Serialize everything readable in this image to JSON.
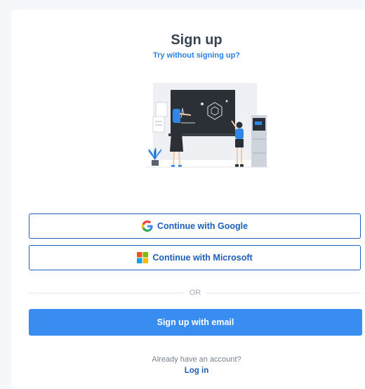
{
  "header": {
    "title": "Sign up",
    "subtitle_link": "Try without signing up?"
  },
  "buttons": {
    "google": "Continue with Google",
    "microsoft": "Continue with Microsoft",
    "email": "Sign up with email"
  },
  "divider": "OR",
  "footer": {
    "prompt": "Already have an account?",
    "login_link": "Log in"
  },
  "colors": {
    "primary": "#3a8df0",
    "outline": "#1d5fb8",
    "title": "#3b4453"
  },
  "icons": {
    "google": "google-g-icon",
    "microsoft": "microsoft-logo-icon"
  }
}
